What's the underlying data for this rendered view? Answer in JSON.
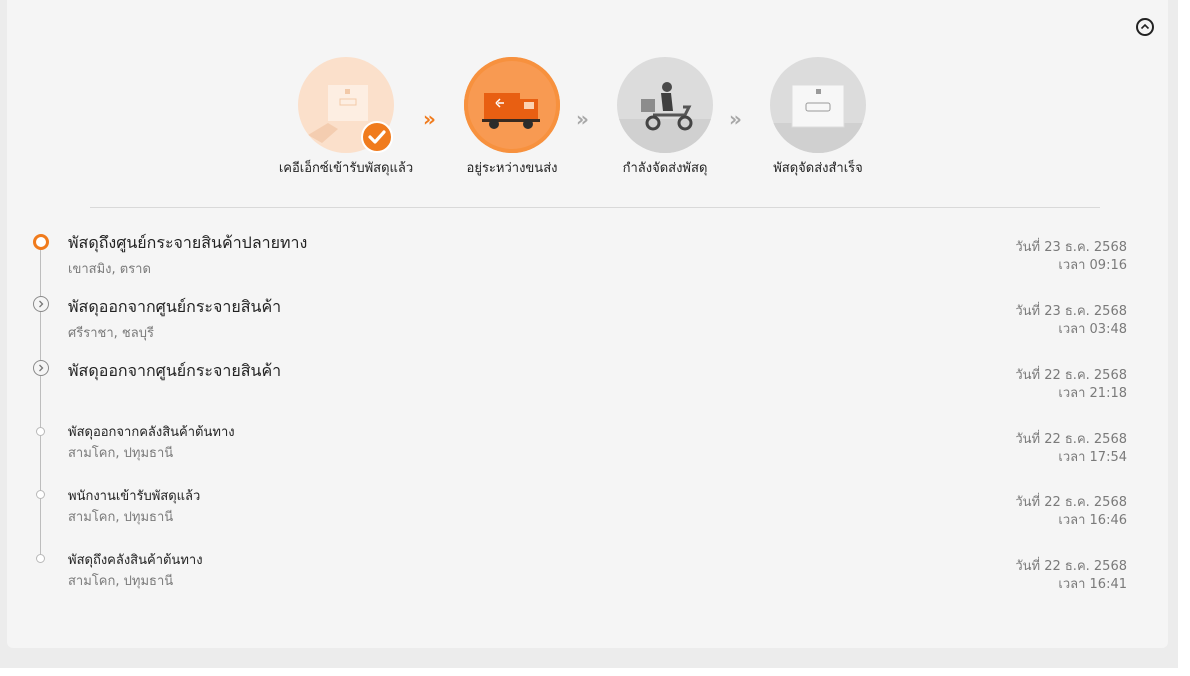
{
  "colors": {
    "accent": "#f07b1d",
    "text_primary": "#222222",
    "text_secondary": "#7a7a7a",
    "card_background": "#f5f5f5"
  },
  "collapse_icon": "chevron-up-circle-icon",
  "steps": [
    {
      "label": "เคอีเอ็กซ์เข้ารับพัสดุแล้ว",
      "status": "done",
      "icon": "parcel-handover-icon"
    },
    {
      "label": "อยู่ระหว่างขนส่ง",
      "status": "active",
      "icon": "delivery-truck-icon"
    },
    {
      "label": "กำลังจัดส่งพัสดุ",
      "status": "pending",
      "icon": "delivery-scooter-icon"
    },
    {
      "label": "พัสดุจัดส่งสำเร็จ",
      "status": "pending",
      "icon": "delivered-box-icon"
    }
  ],
  "timeline": [
    {
      "title": "พัสดุถึงศูนย์กระจายสินค้าปลายทาง",
      "location": "เขาสมิง, ตราด",
      "date": "วันที่ 23 ธ.ค. 2568",
      "time": "เวลา 09:16",
      "marker": "current"
    },
    {
      "title": "พัสดุออกจากศูนย์กระจายสินค้า",
      "location": "ศรีราชา, ชลบุรี",
      "date": "วันที่ 23 ธ.ค. 2568",
      "time": "เวลา 03:48",
      "marker": "arrow"
    },
    {
      "title": "พัสดุออกจากศูนย์กระจายสินค้า",
      "location": "",
      "date": "วันที่ 22 ธ.ค. 2568",
      "time": "เวลา 21:18",
      "marker": "arrow"
    },
    {
      "title": "พัสดุออกจากคลังสินค้าต้นทาง",
      "location": "สามโคก, ปทุมธานี",
      "date": "วันที่ 22 ธ.ค. 2568",
      "time": "เวลา 17:54",
      "marker": "dot"
    },
    {
      "title": "พนักงานเข้ารับพัสดุแล้ว",
      "location": "สามโคก, ปทุมธานี",
      "date": "วันที่ 22 ธ.ค. 2568",
      "time": "เวลา 16:46",
      "marker": "dot"
    },
    {
      "title": "พัสดุถึงคลังสินค้าต้นทาง",
      "location": "สามโคก, ปทุมธานี",
      "date": "วันที่ 22 ธ.ค. 2568",
      "time": "เวลา 16:41",
      "marker": "dot"
    }
  ]
}
